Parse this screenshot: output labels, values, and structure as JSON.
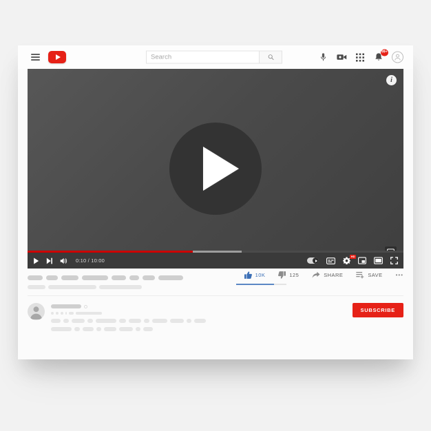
{
  "header": {
    "menu_icon": "hamburger-icon",
    "logo_icon": "youtube-logo",
    "search": {
      "placeholder": "Search",
      "value": "",
      "button_icon": "search-icon"
    },
    "icons": [
      {
        "name": "microphone-icon"
      },
      {
        "name": "video-camera-icon"
      },
      {
        "name": "apps-grid-icon"
      },
      {
        "name": "notifications-bell-icon",
        "badge": "99+"
      },
      {
        "name": "account-avatar-icon"
      }
    ]
  },
  "player": {
    "info_button_label": "i",
    "info_icon": "info-icon",
    "miniplayer_icon": "miniplayer-icon",
    "play_icon": "play-icon",
    "progress": {
      "played_percent": 44,
      "buffered_percent": 57,
      "played_color": "#cc0000",
      "buffer_color": "#9e9e9e",
      "track_color": "#4a4a4a"
    },
    "controls": {
      "play_icon": "play-icon",
      "next_icon": "next-track-icon",
      "volume_icon": "volume-icon",
      "time": "0:10 / 10:00",
      "current_time": "0:10",
      "duration": "10:00",
      "autoplay_icon": "autoplay-toggle",
      "subtitles_icon": "subtitles-cc-icon",
      "settings_icon": "settings-gear-icon",
      "settings_badge": "HD",
      "miniplayer_icon": "miniplayer-icon",
      "theater_icon": "theater-mode-icon",
      "fullscreen_icon": "fullscreen-icon"
    }
  },
  "video_meta": {
    "title_placeholder_widths": [
      22,
      17,
      25,
      38,
      21,
      14,
      18,
      36
    ],
    "meta_placeholder_widths": [
      26,
      70,
      62
    ],
    "meta_separator": "·"
  },
  "actions": [
    {
      "name": "like",
      "icon": "thumbs-up-icon",
      "label": "10K",
      "active": true,
      "color": "#3b6fb6"
    },
    {
      "name": "dislike",
      "icon": "thumbs-down-icon",
      "label": "125",
      "active": false
    },
    {
      "name": "share",
      "icon": "share-arrow-icon",
      "label": "SHARE",
      "active": false
    },
    {
      "name": "save",
      "icon": "save-playlist-icon",
      "label": "SAVE",
      "active": false
    },
    {
      "name": "more",
      "icon": "more-horizontal-icon",
      "label": "•••",
      "active": false
    }
  ],
  "rating_bar": {
    "liked_percent": 75,
    "fill_color": "#5b87c4",
    "track_color": "#e4e4e4"
  },
  "channel": {
    "avatar_icon": "channel-avatar-icon",
    "name_placeholder_width": 44,
    "verified_icon": "verified-badge-icon",
    "subs_placeholder_widths": [
      4,
      4,
      4,
      2,
      7,
      38
    ],
    "description_line1_widths": [
      14,
      8,
      19,
      8,
      30,
      10,
      18,
      8,
      22,
      20,
      7,
      17
    ],
    "description_line2_widths": [
      30,
      8,
      16,
      7,
      18,
      20,
      7,
      14
    ],
    "subscribe_label": "SUBSCRIBE",
    "subscribe_color": "#e62117"
  },
  "theme": {
    "page_background": "#f2f2f2",
    "card_background": "#fbfbfb",
    "brand_red": "#e62117",
    "player_background": "#4a4a4a"
  }
}
